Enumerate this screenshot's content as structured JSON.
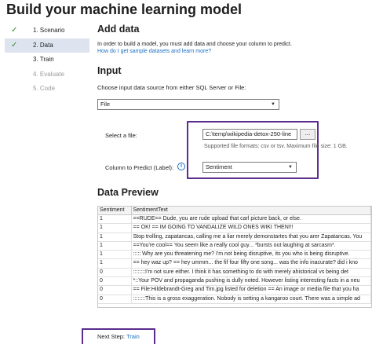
{
  "page_title": "Build your machine learning model",
  "steps": [
    {
      "label": "1. Scenario",
      "done": true
    },
    {
      "label": "2. Data",
      "done": true
    },
    {
      "label": "3. Train",
      "done": false
    },
    {
      "label": "4. Evaluate",
      "done": false
    },
    {
      "label": "5. Code",
      "done": false
    }
  ],
  "check_glyph": "✓",
  "add_data": {
    "heading": "Add data",
    "description": "In order to build a model, you must add data and choose your column to predict.",
    "sample_link": "How do I get sample datasets and learn more?"
  },
  "input": {
    "heading": "Input",
    "source_prompt": "Choose input data source from either SQL Server or File:",
    "source_value": "File",
    "select_file_label": "Select a file:",
    "file_path": "C:\\temp\\wikipedia-detox-250-line",
    "browse_label": "...",
    "formats_hint": "Supported file formats: csv or tsv. Maximum file size: 1 GB.",
    "predict_label": "Column to Predict (Label):",
    "predict_value": "Sentiment",
    "info_glyph": "i"
  },
  "preview": {
    "heading": "Data Preview",
    "columns": [
      "Sentiment",
      "SentimentText"
    ],
    "rows": [
      [
        "1",
        "==RUDE== Dude, you are rude upload that carl picture back, or else."
      ],
      [
        "1",
        "== OK! ==  IM GOING TO VANDALIZE WILD ONES WIKI THEN!!!"
      ],
      [
        "1",
        "Stop trolling, zapatancas, calling me a liar merely demonstartes that you arer Zapatancas. You"
      ],
      [
        "1",
        "==You're cool==  You seem like a really cool guy... *bursts out laughing at sarcasm*."
      ],
      [
        "1",
        "::::: Why are you threatening me? I'm not being disruptive, its you who is being disruptive."
      ],
      [
        "1",
        "== hey waz up? ==  hey ummm... the fif four fifty one song... was the info inacurate?  did i kno"
      ],
      [
        "0",
        "::::::::I'm not sure either. I think it has something to do with merely ahistorical vs being det"
      ],
      [
        "0",
        "*::Your POV and propaganda pushing is dully noted. However listing interesting facts in a neu"
      ],
      [
        "0",
        "== File:Hildebrandt-Greg and Tim.jpg listed for deletion == An image or media file that you ha"
      ],
      [
        "0",
        "::::::::This is a gross exaggeration. Nobody is setting a kangaroo court. There was a simple ad"
      ]
    ]
  },
  "next_step": {
    "prefix": "Next Step:",
    "link": "Train"
  },
  "colors": {
    "accent_link": "#1a6fc4",
    "highlight_border": "#5b2d8e",
    "check_green": "#2e8a2e",
    "active_step_bg": "#dde4f0"
  }
}
